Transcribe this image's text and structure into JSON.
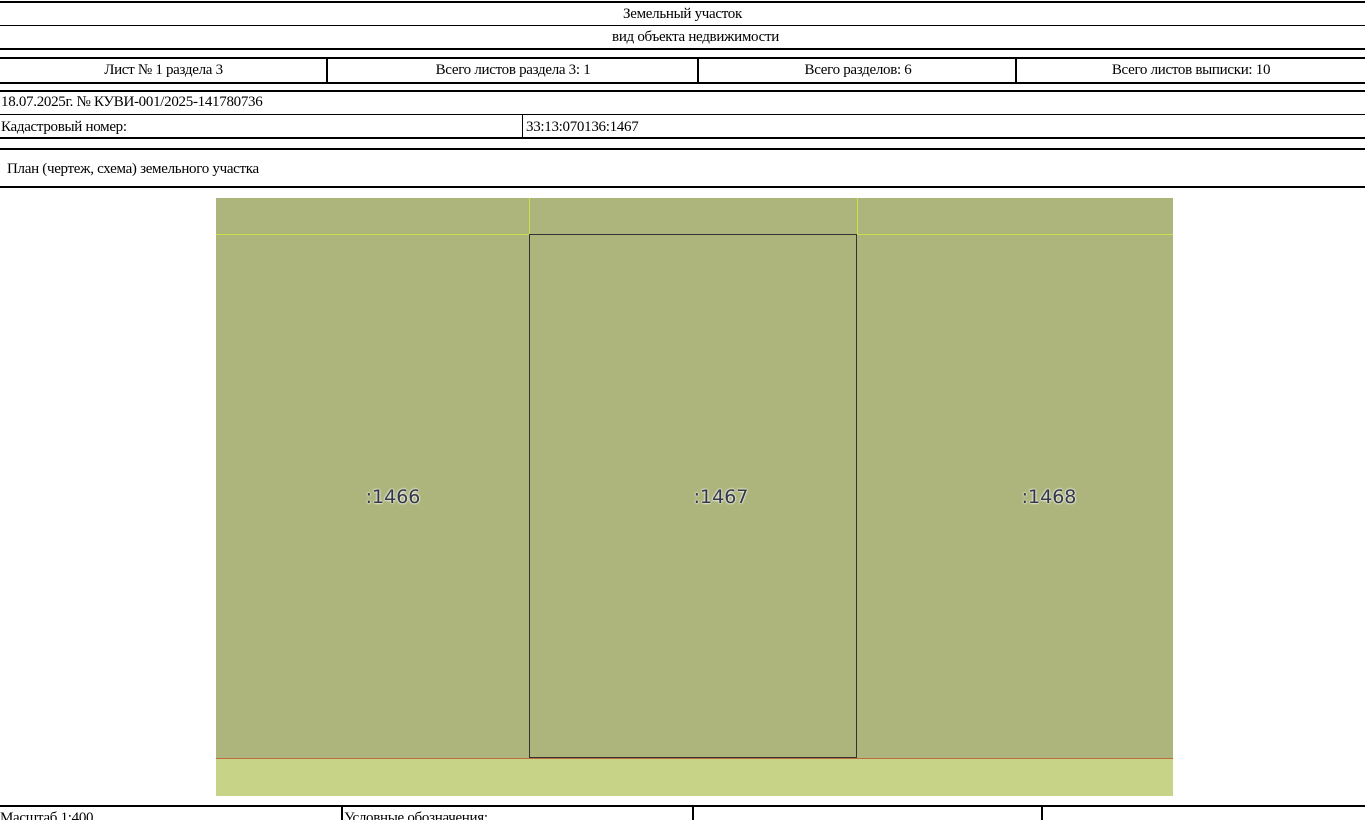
{
  "header": {
    "object_type": "Земельный участок",
    "object_kind_caption": "вид объекта недвижимости"
  },
  "sheet_info": {
    "sheet": "Лист № 1 раздела 3",
    "total_sheets_section": "Всего листов раздела 3: 1",
    "total_sections": "Всего разделов: 6",
    "total_sheets_extract": "Всего листов выписки: 10"
  },
  "extract_ref": "18.07.2025г. № КУВИ-001/2025-141780736",
  "cadastral": {
    "label": "Кадастровый номер:",
    "value": "33:13:070136:1467"
  },
  "plan_title": "План (чертеж, схема) земельного участка",
  "parcels": [
    ":1466",
    ":1467",
    ":1468"
  ],
  "footer": {
    "scale": "Масштаб 1:400",
    "legend": "Условные обозначения:"
  },
  "colors": {
    "parcel_fill": "#adb57c",
    "road_strip": "#c7d488",
    "boundary_yellow": "#c8e04a"
  }
}
